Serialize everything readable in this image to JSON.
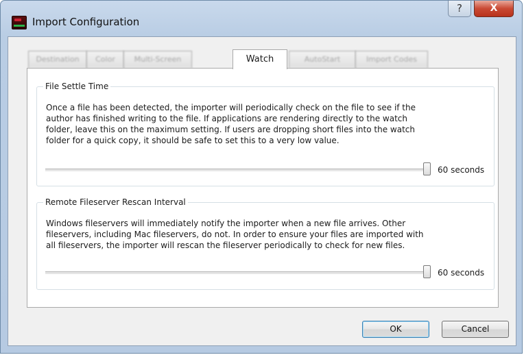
{
  "window": {
    "title": "Import Configuration",
    "help_glyph": "?",
    "close_glyph": "X"
  },
  "tabs": [
    {
      "label": "Destination",
      "active": false
    },
    {
      "label": "Color",
      "active": false
    },
    {
      "label": "Multi-Screen",
      "active": false
    },
    {
      "label": "Watch",
      "active": true
    },
    {
      "label": "AutoStart",
      "active": false
    },
    {
      "label": "Import Codes",
      "active": false
    }
  ],
  "file_settle": {
    "title": "File Settle Time",
    "lines": [
      "Once a file has been detected, the importer will periodically check on the file to see if the",
      "author has finished writing to the file. If applications are rendering directly to the watch",
      "folder, leave this on the maximum setting. If users are dropping short files into the watch",
      "folder for a quick copy, it should be safe to set this to a very low value."
    ],
    "slider_fraction": 1.0,
    "value_label": "60 seconds"
  },
  "rescan": {
    "title": "Remote Fileserver Rescan Interval",
    "lines": [
      "Windows fileservers will immediately notify the importer when a new file arrives. Other",
      "fileservers, including Mac fileservers, do not. In order to ensure your files are imported with",
      "all fileservers, the importer will rescan the fileserver periodically to check for new files."
    ],
    "slider_fraction": 1.0,
    "value_label": "60 seconds"
  },
  "buttons": {
    "ok": "OK",
    "cancel": "Cancel"
  },
  "colors": {
    "titlebar": "#b9cde4",
    "close_button": "#c94a34",
    "default_button_border": "#3c7fb1"
  }
}
